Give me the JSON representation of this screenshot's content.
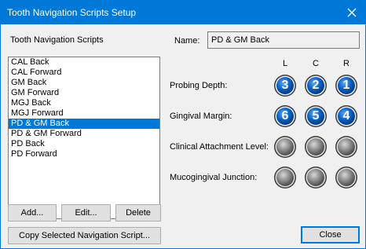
{
  "window": {
    "title": "Tooth Navigation Scripts Setup",
    "close_icon": "close-icon"
  },
  "left": {
    "section_label": "Tooth Navigation Scripts",
    "scripts": [
      {
        "label": "CAL Back",
        "selected": false
      },
      {
        "label": "CAL Forward",
        "selected": false
      },
      {
        "label": "GM Back",
        "selected": false
      },
      {
        "label": "GM Forward",
        "selected": false
      },
      {
        "label": "MGJ Back",
        "selected": false
      },
      {
        "label": "MGJ Forward",
        "selected": false
      },
      {
        "label": "PD & GM Back",
        "selected": true
      },
      {
        "label": "PD & GM Forward",
        "selected": false
      },
      {
        "label": "PD Back",
        "selected": false
      },
      {
        "label": "PD Forward",
        "selected": false
      }
    ],
    "buttons": {
      "add": "Add...",
      "edit": "Edit...",
      "delete": "Delete",
      "copy": "Copy Selected Navigation Script..."
    }
  },
  "right": {
    "name_label": "Name:",
    "name_value": "PD & GM Back",
    "columns": [
      "L",
      "C",
      "R"
    ],
    "rows": [
      {
        "label": "Probing Depth:",
        "values": [
          "3",
          "2",
          "1"
        ]
      },
      {
        "label": "Gingival Margin:",
        "values": [
          "6",
          "5",
          "4"
        ]
      },
      {
        "label": "Clinical Attachment Level:",
        "values": [
          "",
          "",
          ""
        ]
      },
      {
        "label": "Mucogingival Junction:",
        "values": [
          "",
          "",
          ""
        ]
      }
    ],
    "close_label": "Close"
  },
  "colors": {
    "title_bar": "#0078d7",
    "selection": "#0078d7",
    "active_circle": "#0a62c4",
    "inactive_circle": "#8a8a8a"
  }
}
